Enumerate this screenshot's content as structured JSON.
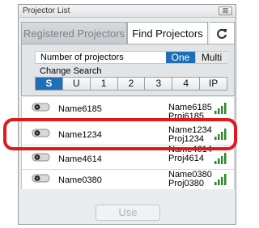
{
  "window": {
    "title": "Projector List",
    "close_label": "⊠"
  },
  "tabs": {
    "registered_label": "Registered Projectors",
    "find_label": "Find Projectors",
    "refresh_label": "C"
  },
  "panel": {
    "number_label": "Number of projectors",
    "one_label": "One",
    "multi_label": "Multi",
    "selected": "One",
    "change_search_label": "Change Search",
    "search_buttons": [
      "S",
      "U",
      "1",
      "2",
      "3",
      "4",
      "IP"
    ],
    "search_selected": "S"
  },
  "projectors": [
    {
      "name": "Name6185",
      "right_line1": "Name6185",
      "right_line2": "Proj6185",
      "signal_bars": 4
    },
    {
      "name": "Name1234",
      "right_line1": "Name1234",
      "right_line2": "Proj1234",
      "signal_bars": 4
    },
    {
      "name": "Name4614",
      "right_line1": "Name4614",
      "right_line2": "Proj4614",
      "signal_bars": 4
    },
    {
      "name": "Name0380",
      "right_line1": "Name0380",
      "right_line2": "Proj0380",
      "signal_bars": 4
    }
  ],
  "footer": {
    "use_label": "Use"
  },
  "colors": {
    "accent": "#1e6fb8",
    "highlight": "#e11919"
  }
}
